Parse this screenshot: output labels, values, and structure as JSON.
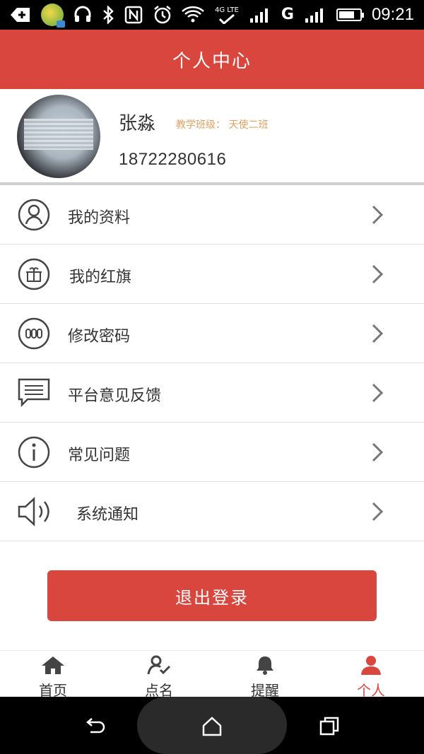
{
  "status_bar": {
    "time": "09:21",
    "network_label": "4G LTE",
    "carrier_g": "G",
    "icons": [
      "back-plus-icon",
      "app-badge-icon",
      "headset-icon",
      "bluetooth-icon",
      "nfc-icon",
      "alarm-icon",
      "wifi-icon",
      "signal-icon",
      "battery-icon"
    ],
    "battery_level": 0.75
  },
  "header": {
    "title": "个人中心"
  },
  "profile": {
    "name": "张淼",
    "class_info": "教学班级： 天使二班",
    "phone": "18722280616"
  },
  "menu": {
    "items": [
      {
        "label": "我的资料",
        "icon": "user-circle-icon"
      },
      {
        "label": "我的红旗",
        "icon": "gift-circle-icon"
      },
      {
        "label": "修改密码",
        "icon": "password-circle-icon"
      },
      {
        "label": "平台意见反馈",
        "icon": "feedback-chat-icon"
      },
      {
        "label": "常见问题",
        "icon": "info-circle-icon"
      },
      {
        "label": "系统通知",
        "icon": "speaker-icon"
      }
    ]
  },
  "logout_label": "退出登录",
  "bottom_nav": {
    "items": [
      {
        "label": "首页",
        "icon": "home-icon",
        "active": false
      },
      {
        "label": "点名",
        "icon": "roll-call-icon",
        "active": false
      },
      {
        "label": "提醒",
        "icon": "bell-icon",
        "active": false
      },
      {
        "label": "个人",
        "icon": "person-icon",
        "active": true
      }
    ]
  },
  "colors": {
    "accent": "#d9463e",
    "class_info": "#e6a060",
    "text": "#333333",
    "divider": "#e2e2e2"
  }
}
